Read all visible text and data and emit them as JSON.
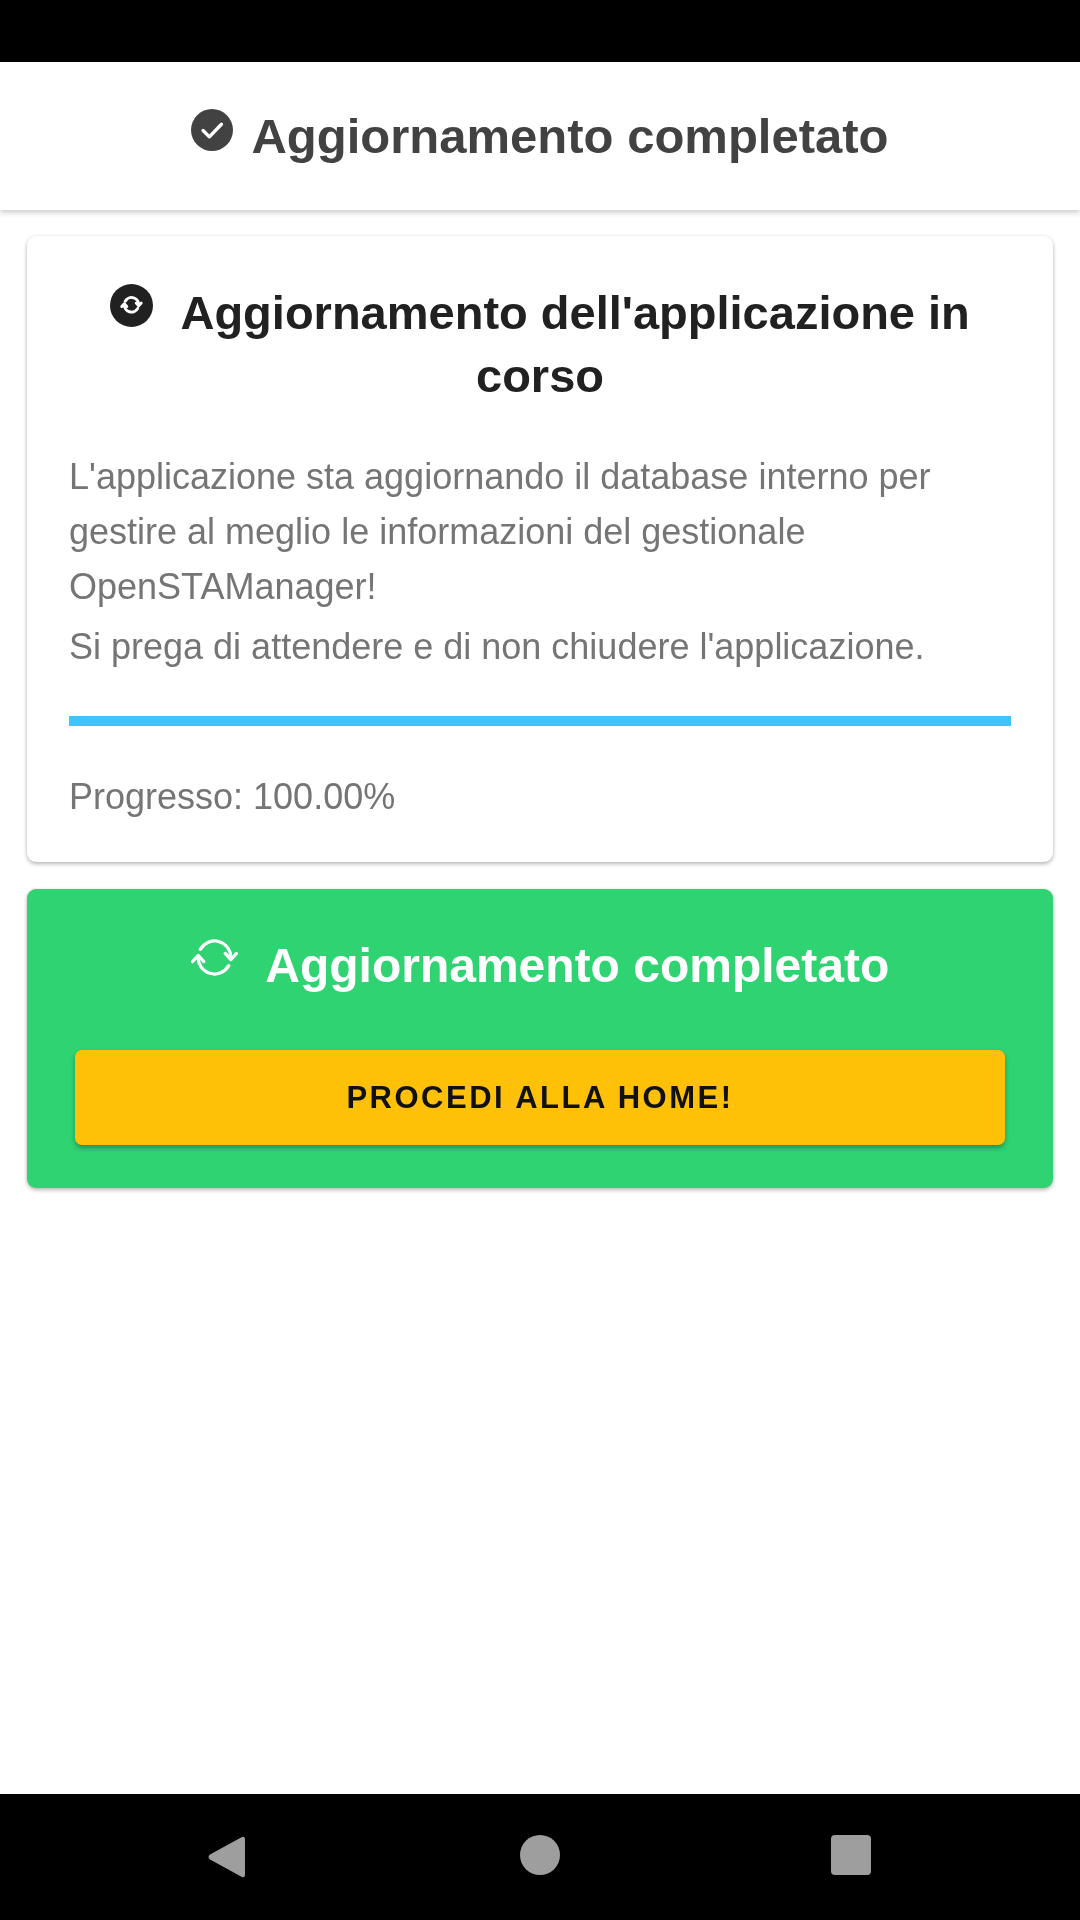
{
  "header": {
    "title": "Aggiornamento completato"
  },
  "progress_card": {
    "title": "Aggiornamento dell'applicazione in corso",
    "paragraphs": [
      "L'applicazione sta aggiornando il database interno per gestire al meglio le informazioni del gestionale OpenSTAManager!",
      "Si prega di attendere e di non chiudere l'applicazione."
    ],
    "progress": {
      "level": 1
    },
    "progress_label": "Progresso: 100.00%"
  },
  "result_card": {
    "title": "Aggiornamento completato",
    "button": "PROCEDI ALLA HOME!"
  }
}
